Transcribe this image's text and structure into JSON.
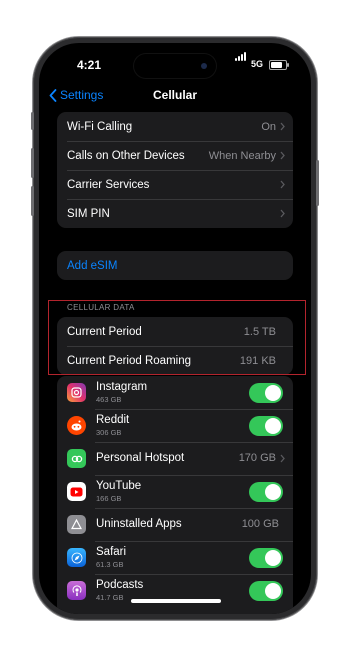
{
  "status": {
    "time": "4:21",
    "network": "5G"
  },
  "nav": {
    "back_label": "Settings",
    "title": "Cellular"
  },
  "settings_rows": [
    {
      "label": "Wi-Fi Calling",
      "value": "On"
    },
    {
      "label": "Calls on Other Devices",
      "value": "When Nearby"
    },
    {
      "label": "Carrier Services",
      "value": ""
    },
    {
      "label": "SIM PIN",
      "value": ""
    }
  ],
  "add_esim_label": "Add eSIM",
  "cellular_data": {
    "header": "CELLULAR DATA",
    "rows": [
      {
        "label": "Current Period",
        "value": "1.5 TB"
      },
      {
        "label": "Current Period Roaming",
        "value": "191 KB"
      }
    ]
  },
  "apps": [
    {
      "name": "Instagram",
      "size": "463 GB",
      "toggle_on": true,
      "icon": "instagram-icon"
    },
    {
      "name": "Reddit",
      "size": "306 GB",
      "toggle_on": true,
      "icon": "reddit-icon"
    },
    {
      "name": "Personal Hotspot",
      "value": "170 GB",
      "icon": "hotspot-icon"
    },
    {
      "name": "YouTube",
      "size": "166 GB",
      "toggle_on": true,
      "icon": "youtube-icon"
    },
    {
      "name": "Uninstalled Apps",
      "value": "100 GB",
      "icon": "uninstalled-apps-icon"
    },
    {
      "name": "Safari",
      "size": "61.3 GB",
      "toggle_on": true,
      "icon": "safari-icon"
    },
    {
      "name": "Podcasts",
      "size": "41.7 GB",
      "toggle_on": true,
      "icon": "podcasts-icon"
    }
  ],
  "colors": {
    "accent": "#0a84ff",
    "toggle_on": "#34c759",
    "highlight_box": "#b3242d",
    "cell_bg": "#1c1c1e"
  }
}
